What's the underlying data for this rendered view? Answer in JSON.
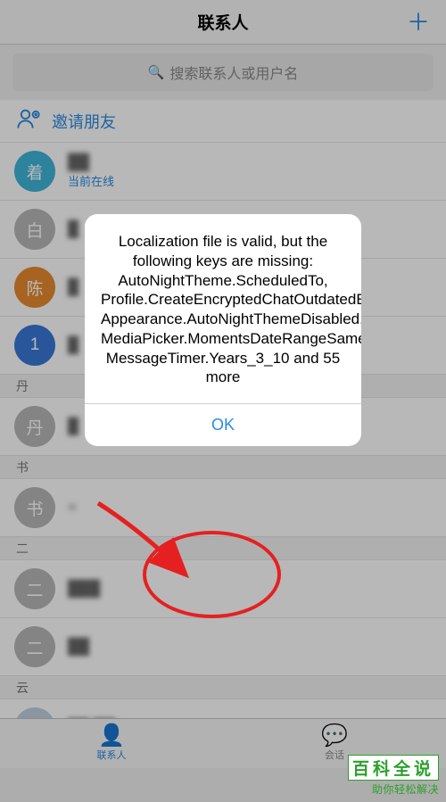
{
  "header": {
    "title": "联系人",
    "add_icon": "plus"
  },
  "search": {
    "placeholder": "搜索联系人或用户名"
  },
  "invite": {
    "label": "邀请朋友"
  },
  "contacts": [
    {
      "avatar_text": "着",
      "avatar_color": "#3fb5d9",
      "name": "██",
      "status": "当前在线"
    },
    {
      "avatar_text": "白",
      "avatar_color": "#b8b8b8",
      "name": "█",
      "status": ""
    },
    {
      "avatar_text": "陈",
      "avatar_color": "#e68a2e",
      "name": "█",
      "status": ""
    },
    {
      "avatar_text": "1",
      "avatar_color": "#3a78d6",
      "name": "█",
      "status": ""
    }
  ],
  "sections": {
    "dan": "丹",
    "dan_item": {
      "avatar_text": "丹",
      "avatar_color": "#b8b8b8",
      "name": "█"
    },
    "shu": "书",
    "shu_item": {
      "avatar_text": "书",
      "avatar_color": "#b8b8b8",
      "name": "="
    },
    "er": "二",
    "er_item1": {
      "avatar_text": "二",
      "avatar_color": "#b8b8b8",
      "name": "███"
    },
    "er_item2": {
      "avatar_text": "二",
      "avatar_color": "#b8b8b8",
      "name": "██"
    },
    "yun": "云",
    "yun_item": {
      "avatar_text": "",
      "avatar_color": "#c0d0e0",
      "name": "██ ██"
    }
  },
  "tabs": {
    "contacts": "联系人",
    "chats": "会话"
  },
  "alert": {
    "message": "Localization file is valid, but the following keys are missing:\nAutoNightTheme.ScheduledTo,\nProfile.CreateEncryptedChatOutdatedError,\nAppearance.AutoNightThemeDisabled,\nMediaPicker.MomentsDateRangeSameMonthYearFormat,\nMessageTimer.Years_3_10 and 55 more",
    "ok": "OK"
  },
  "watermark": {
    "title": "百科全说",
    "subtitle": "助你轻松解决"
  },
  "colors": {
    "accent": "#2a8ae0",
    "annotation": "#e62020"
  }
}
